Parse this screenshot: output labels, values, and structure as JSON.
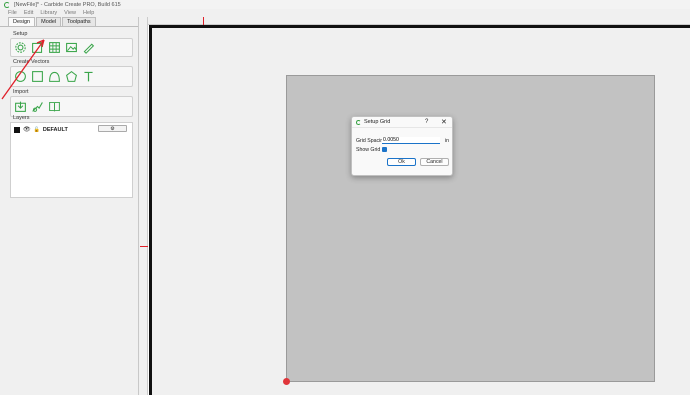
{
  "window": {
    "title": "[NewFile]* - Carbide Create PRO, Build 615"
  },
  "menu": [
    "File",
    "Edit",
    "Library",
    "View",
    "Help"
  ],
  "tabs": [
    "Design",
    "Model",
    "Toolpaths"
  ],
  "sections": {
    "setup": "Setup",
    "create": "Create Vectors",
    "import": "Import",
    "layers": "Layers"
  },
  "layers": [
    {
      "name": "DEFAULT",
      "color": "#111111"
    }
  ],
  "dialog": {
    "title": "Setup Grid",
    "grid_spacing_label": "Grid Spacing",
    "grid_spacing_value": "0.0050",
    "unit": "in",
    "show_grid_label": "Show Grid",
    "show_grid_checked": true,
    "ok_label": "Ok",
    "cancel_label": "Cancel"
  },
  "colors": {
    "accent": "#1a73c9",
    "tool_green": "#3aa54a",
    "annotation_red": "#e0202a"
  }
}
